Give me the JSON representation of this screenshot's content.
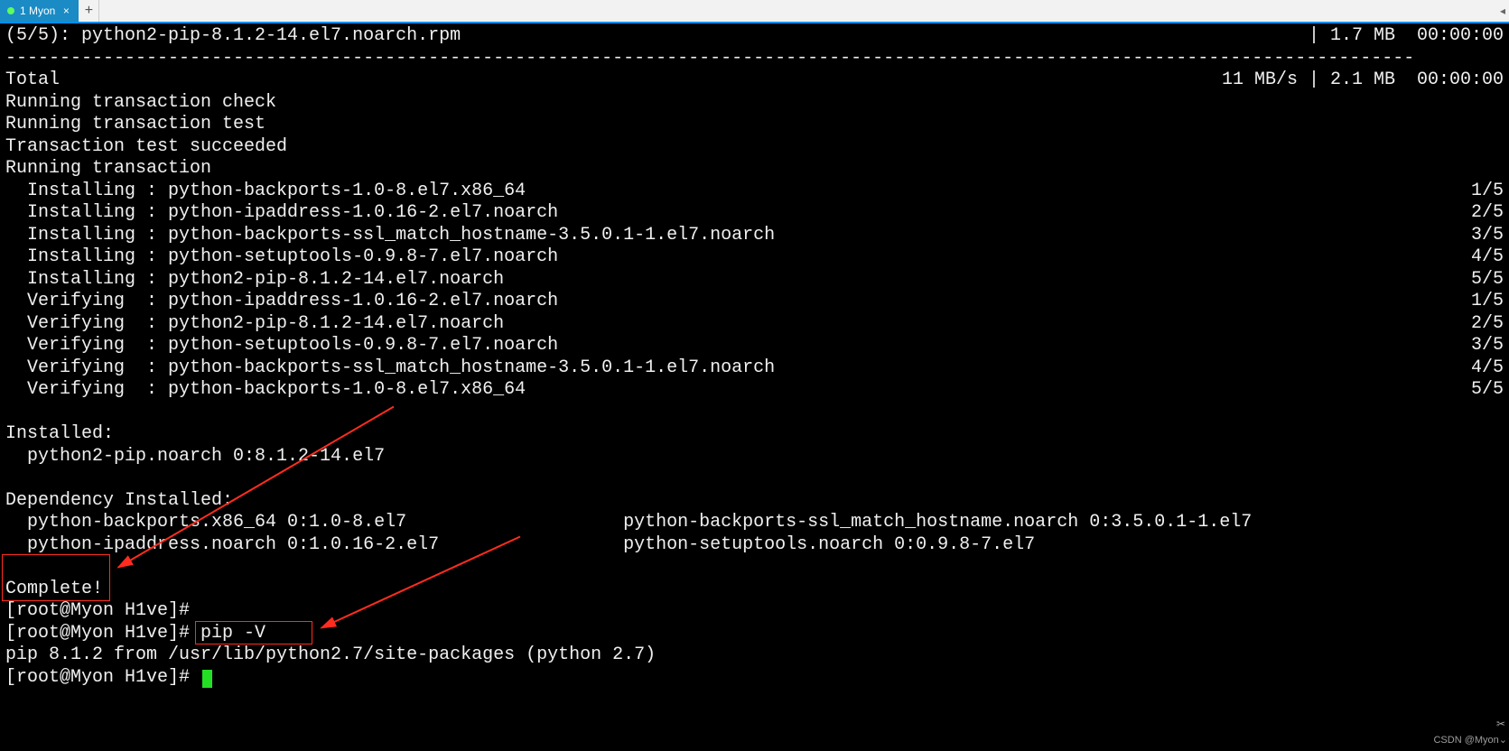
{
  "tabbar": {
    "tab_label": "1 Myon",
    "close_glyph": "×",
    "new_glyph": "+",
    "overflow_glyph": "◂"
  },
  "header_line": {
    "left": "(5/5): python2-pip-8.1.2-14.el7.noarch.rpm",
    "right": "| 1.7 MB  00:00:00"
  },
  "total_line": {
    "left": "Total",
    "right": "11 MB/s | 2.1 MB  00:00:00"
  },
  "running_lines": [
    "Running transaction check",
    "Running transaction test",
    "Transaction test succeeded",
    "Running transaction"
  ],
  "installing": [
    {
      "pkg": "python-backports-1.0-8.el7.x86_64",
      "n": "1/5"
    },
    {
      "pkg": "python-ipaddress-1.0.16-2.el7.noarch",
      "n": "2/5"
    },
    {
      "pkg": "python-backports-ssl_match_hostname-3.5.0.1-1.el7.noarch",
      "n": "3/5"
    },
    {
      "pkg": "python-setuptools-0.9.8-7.el7.noarch",
      "n": "4/5"
    },
    {
      "pkg": "python2-pip-8.1.2-14.el7.noarch",
      "n": "5/5"
    }
  ],
  "verifying": [
    {
      "pkg": "python-ipaddress-1.0.16-2.el7.noarch",
      "n": "1/5"
    },
    {
      "pkg": "python2-pip-8.1.2-14.el7.noarch",
      "n": "2/5"
    },
    {
      "pkg": "python-setuptools-0.9.8-7.el7.noarch",
      "n": "3/5"
    },
    {
      "pkg": "python-backports-ssl_match_hostname-3.5.0.1-1.el7.noarch",
      "n": "4/5"
    },
    {
      "pkg": "python-backports-1.0-8.el7.x86_64",
      "n": "5/5"
    }
  ],
  "installed": {
    "head": "Installed:",
    "line": "  python2-pip.noarch 0:8.1.2-14.el7"
  },
  "dep_installed": {
    "head": "Dependency Installed:",
    "rows": [
      {
        "a": "  python-backports.x86_64 0:1.0-8.el7",
        "b": "python-backports-ssl_match_hostname.noarch 0:3.5.0.1-1.el7"
      },
      {
        "a": "  python-ipaddress.noarch 0:1.0.16-2.el7",
        "b": "python-setuptools.noarch 0:0.9.8-7.el7"
      }
    ]
  },
  "complete": "Complete!",
  "prompt": "[root@Myon H1ve]# ",
  "cmd": "pip -V",
  "pip_out": "pip 8.1.2 from /usr/lib/python2.7/site-packages (python 2.7)",
  "watermark": "CSDN @Myon⌄",
  "cut": "⌄"
}
